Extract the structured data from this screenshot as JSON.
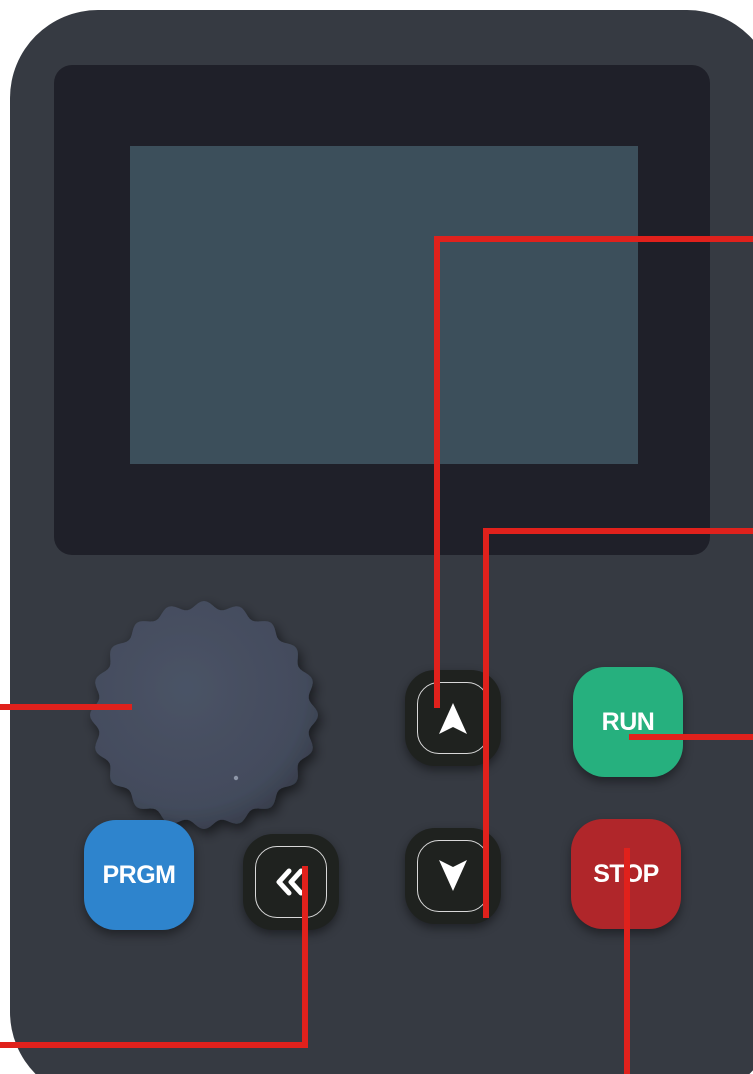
{
  "keypad": {
    "run_label": "RUN",
    "stop_label": "STOP",
    "prgm_label": "PRGM"
  },
  "colors": {
    "panel": "#363a42",
    "bezel": "#1f2029",
    "screen": "#3c4f5b",
    "knob": "#434b5c",
    "run": "#26b07e",
    "stop": "#b0262a",
    "prgm": "#2e84cd",
    "leader_line": "#e0211c"
  },
  "icons": {
    "up": "arrow-up-icon",
    "down": "arrow-down-icon",
    "shift": "double-chevron-left-icon"
  }
}
